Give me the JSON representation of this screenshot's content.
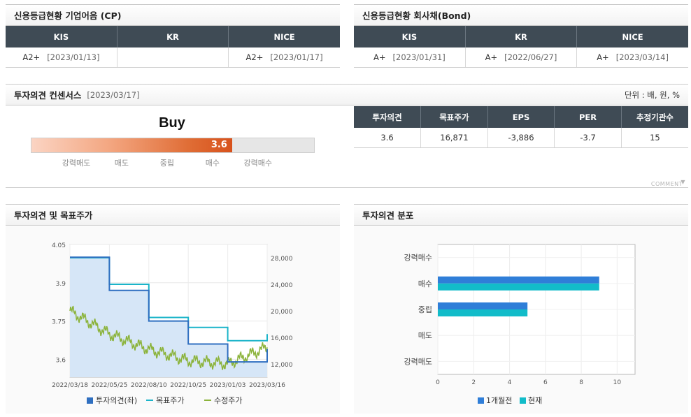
{
  "cp": {
    "title": "신용등급현황 기업어음 (CP)",
    "headers": [
      "KIS",
      "KR",
      "NICE"
    ],
    "cells": [
      {
        "grade": "A2+",
        "date": "[2023/01/13]"
      },
      {
        "grade": "",
        "date": ""
      },
      {
        "grade": "A2+",
        "date": "[2023/01/17]"
      }
    ]
  },
  "bond": {
    "title": "신용등급현황 회사채(Bond)",
    "headers": [
      "KIS",
      "KR",
      "NICE"
    ],
    "cells": [
      {
        "grade": "A+",
        "date": "[2023/01/31]"
      },
      {
        "grade": "A+",
        "date": "[2022/06/27]"
      },
      {
        "grade": "A+",
        "date": "[2023/03/14]"
      }
    ]
  },
  "consensus": {
    "title": "투자의견 컨센서스",
    "date": "[2023/03/17]",
    "unit": "단위 : 배, 원, %",
    "opinion": "Buy",
    "score": "3.6",
    "score_value": 3.6,
    "scale": [
      "강력매도",
      "매도",
      "중립",
      "매수",
      "강력매수"
    ],
    "headers": [
      "투자의견",
      "목표주가",
      "EPS",
      "PER",
      "추정기관수"
    ],
    "values": [
      "3.6",
      "16,871",
      "-3,886",
      "-3.7",
      "15"
    ],
    "comment_label": "COMMENT"
  },
  "opinion_chart": {
    "title": "투자의견 및 목표주가",
    "legend": [
      "투자의견(좌)",
      "목표주가",
      "수정주가"
    ],
    "colors": {
      "opinion": "#2f6fc0",
      "target": "#1bb4c9",
      "price": "#8bb33a"
    },
    "left_ticks": [
      "4.05",
      "3.9",
      "3.75",
      "3.6"
    ],
    "right_ticks": [
      "28,000",
      "24,000",
      "20,000",
      "16,000",
      "12,000"
    ],
    "x_ticks": [
      "2022/03/18",
      "2022/05/25",
      "2022/08/10",
      "2022/10/25",
      "2023/01/03",
      "2023/03/16"
    ]
  },
  "distribution_chart": {
    "title": "투자의견 분포",
    "categories": [
      "강력매수",
      "매수",
      "중립",
      "매도",
      "강력매도"
    ],
    "x_ticks": [
      "0",
      "2",
      "4",
      "6",
      "8",
      "10"
    ],
    "legend": [
      "1개월전",
      "현재"
    ],
    "colors": {
      "prev": "#2f7ed8",
      "curr": "#12bcc9"
    }
  },
  "chart_data": [
    {
      "type": "line",
      "title": "투자의견 및 목표주가",
      "x": [
        "2022/03/18",
        "2022/05/25",
        "2022/08/10",
        "2022/10/25",
        "2023/01/03",
        "2023/03/16"
      ],
      "series": [
        {
          "name": "투자의견(좌)",
          "axis": "left",
          "values": [
            4.0,
            3.87,
            3.75,
            3.66,
            3.59,
            3.64
          ]
        },
        {
          "name": "목표주가",
          "axis": "right",
          "values": [
            28000,
            24000,
            19000,
            17500,
            15500,
            16500
          ]
        },
        {
          "name": "수정주가",
          "axis": "right",
          "values": [
            20000,
            16500,
            14200,
            12500,
            12000,
            14500
          ]
        }
      ],
      "ylim_left": [
        3.53,
        4.05
      ],
      "ylim_right": [
        10000,
        30000
      ]
    },
    {
      "type": "bar",
      "title": "투자의견 분포",
      "categories": [
        "강력매수",
        "매수",
        "중립",
        "매도",
        "강력매도"
      ],
      "series": [
        {
          "name": "1개월전",
          "values": [
            0,
            9,
            5,
            0,
            0
          ]
        },
        {
          "name": "현재",
          "values": [
            0,
            9,
            5,
            0,
            0
          ]
        }
      ],
      "xlim": [
        0,
        11
      ]
    }
  ]
}
